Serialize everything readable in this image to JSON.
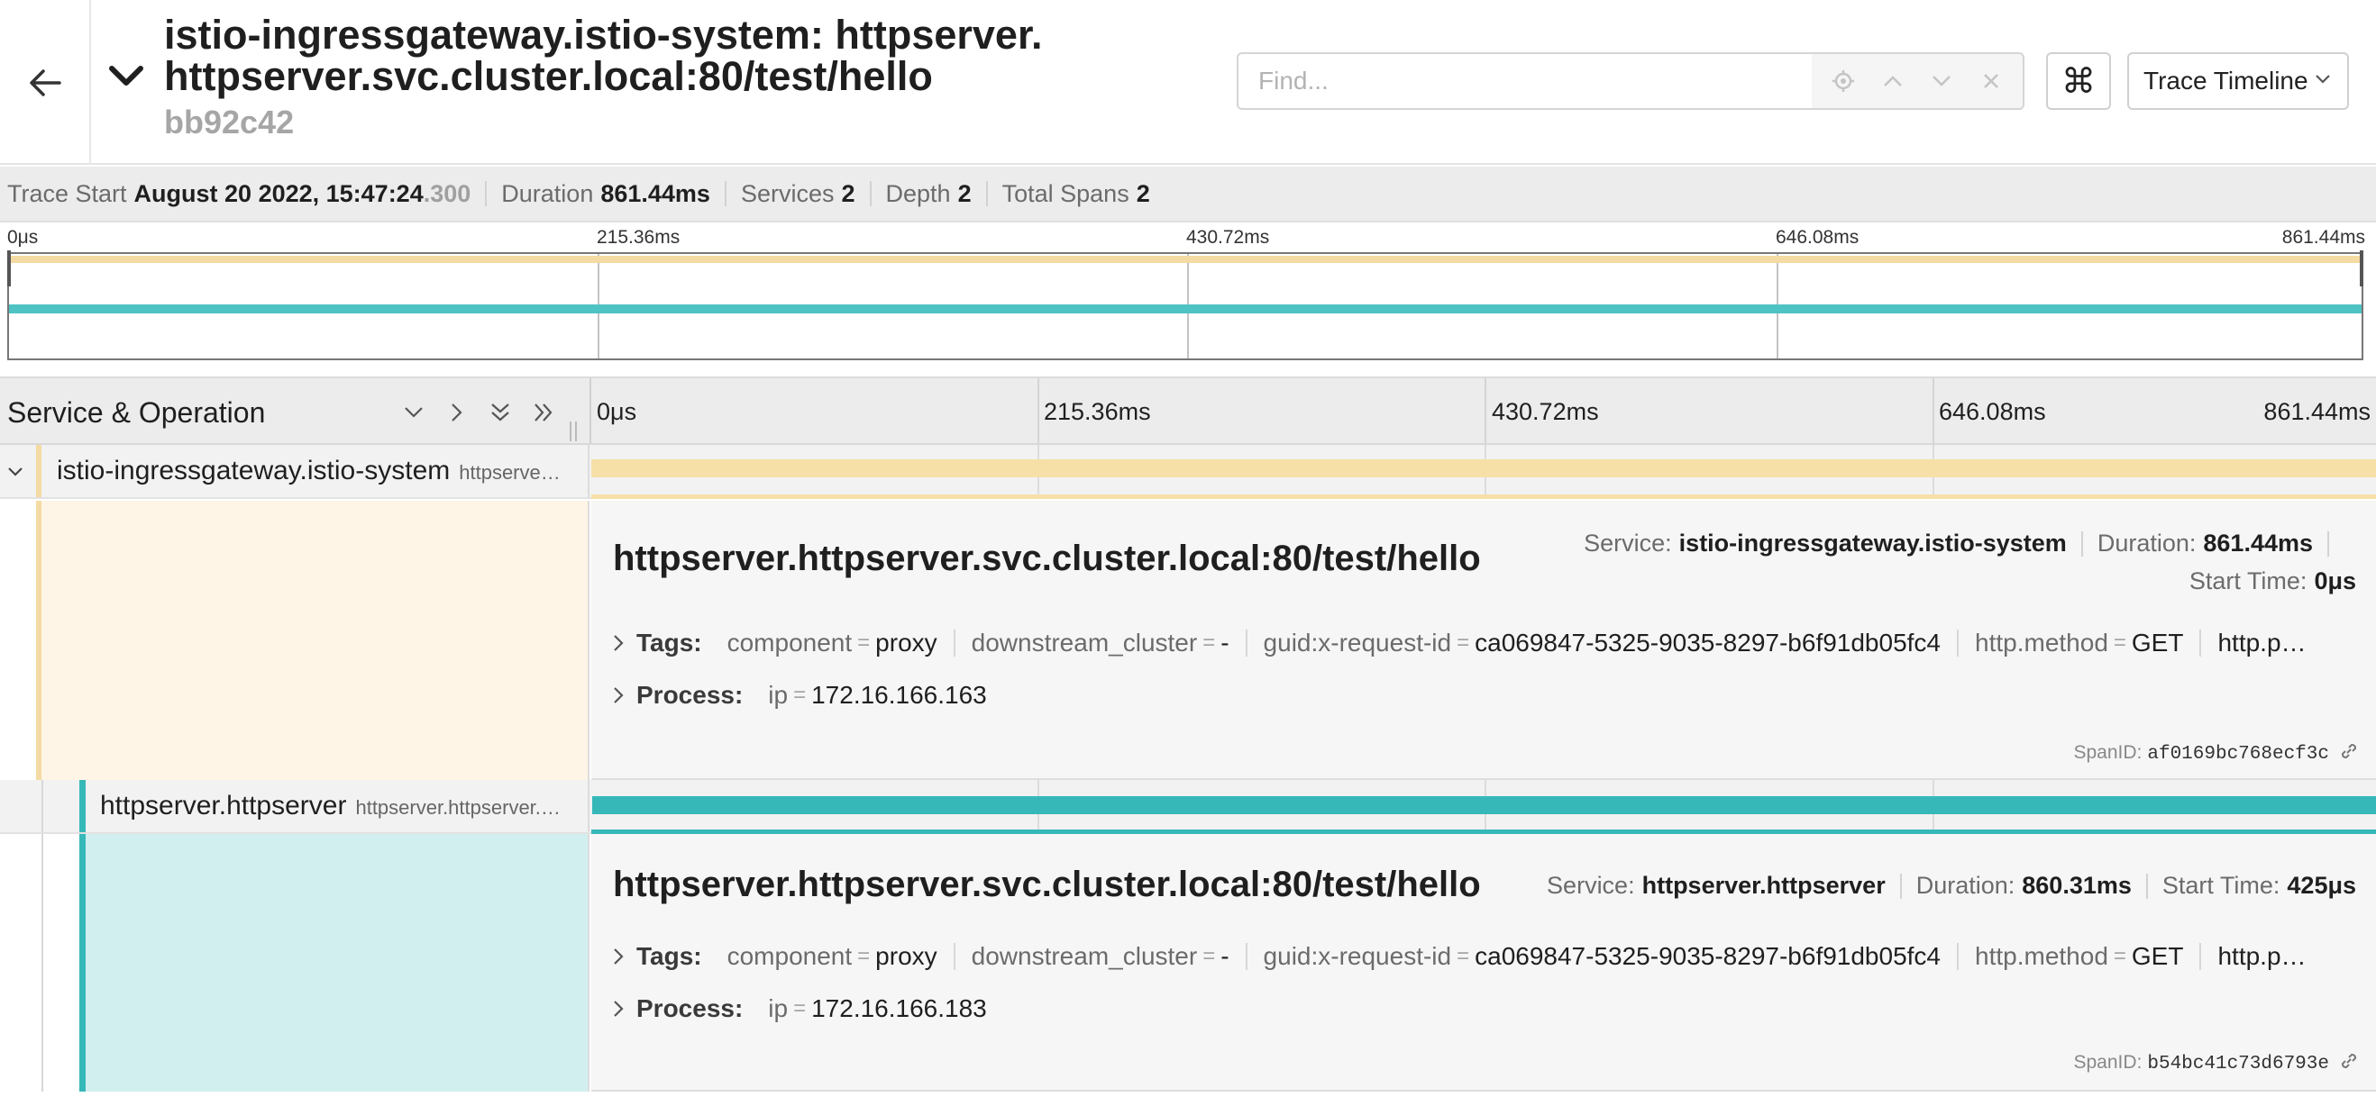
{
  "header": {
    "title": "istio-ingressgateway.istio-system: httpserver. httpserver.svc.cluster.local:80/test/hello",
    "trace_id": "bb92c42",
    "find_placeholder": "Find...",
    "keyboard_shortcut_glyph": "⌘",
    "view_selector": "Trace Timeline"
  },
  "summary": {
    "trace_start_label": "Trace Start",
    "trace_start_value": "August 20 2022, 15:47:24",
    "trace_start_ms": ".300",
    "duration_label": "Duration",
    "duration_value": "861.44ms",
    "services_label": "Services",
    "services_value": "2",
    "depth_label": "Depth",
    "depth_value": "2",
    "total_spans_label": "Total Spans",
    "total_spans_value": "2"
  },
  "ticks": [
    "0μs",
    "215.36ms",
    "430.72ms",
    "646.08ms",
    "861.44ms"
  ],
  "timeline": {
    "column_title": "Service & Operation"
  },
  "colors": {
    "ingress": "#f4dba3",
    "ingress_panel": "#fef5e6",
    "httpserver": "#36b8b9",
    "httpserver_panel": "#d2eff0"
  },
  "spans": [
    {
      "service": "istio-ingressgateway.istio-system",
      "operation_short": "httpserve…",
      "operation": "httpserver.httpserver.svc.cluster.local:80/test/hello",
      "service_label": "Service:",
      "duration_label": "Duration:",
      "duration": "861.44ms",
      "start_label": "Start Time:",
      "start": "0μs",
      "tags_label": "Tags:",
      "process_label": "Process:",
      "tags": [
        {
          "k": "component",
          "v": "proxy"
        },
        {
          "k": "downstream_cluster",
          "v": "-"
        },
        {
          "k": "guid:x-request-id",
          "v": "ca069847-5325-9035-8297-b6f91db05fc4"
        },
        {
          "k": "http.method",
          "v": "GET"
        },
        {
          "k": "http.p…",
          "v": ""
        }
      ],
      "process": {
        "k": "ip",
        "v": "172.16.166.163"
      },
      "span_id_label": "SpanID:",
      "span_id": "af0169bc768ecf3c"
    },
    {
      "service": "httpserver.httpserver",
      "operation_short": "httpserver.httpserver.…",
      "operation": "httpserver.httpserver.svc.cluster.local:80/test/hello",
      "service_label": "Service:",
      "duration_label": "Duration:",
      "duration": "860.31ms",
      "start_label": "Start Time:",
      "start": "425μs",
      "tags_label": "Tags:",
      "process_label": "Process:",
      "tags": [
        {
          "k": "component",
          "v": "proxy"
        },
        {
          "k": "downstream_cluster",
          "v": "-"
        },
        {
          "k": "guid:x-request-id",
          "v": "ca069847-5325-9035-8297-b6f91db05fc4"
        },
        {
          "k": "http.method",
          "v": "GET"
        },
        {
          "k": "http.p…",
          "v": ""
        }
      ],
      "process": {
        "k": "ip",
        "v": "172.16.166.183"
      },
      "span_id_label": "SpanID:",
      "span_id": "b54bc41c73d6793e"
    }
  ]
}
